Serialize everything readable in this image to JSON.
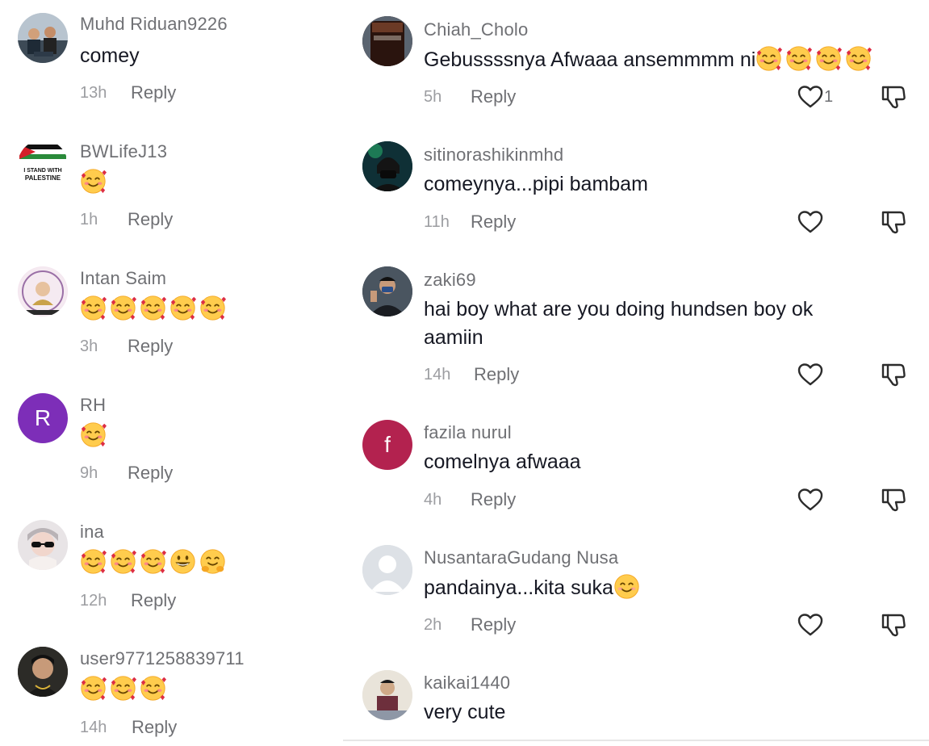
{
  "colors": {
    "text": "#161823",
    "muted": "#9c9da1",
    "secondary": "#6f7074",
    "avatar_r": "#7d2eb8",
    "avatar_f": "#b3224f"
  },
  "left_comments": [
    {
      "username": "Muhd Riduan9226",
      "text": "comey",
      "emojis": [],
      "time": "13h",
      "reply": "Reply"
    },
    {
      "username": "BWLifeJ13",
      "text": "",
      "emojis": [
        "smiling-face-with-hearts"
      ],
      "time": "1h",
      "reply": "Reply",
      "avatar_text": [
        "I STAND WITH",
        "PALESTINE"
      ]
    },
    {
      "username": "Intan Saim",
      "text": "",
      "emojis": [
        "smiling-face-with-hearts",
        "smiling-face-with-hearts",
        "smiling-face-with-hearts",
        "smiling-face-with-hearts",
        "smiling-face-with-hearts"
      ],
      "time": "3h",
      "reply": "Reply"
    },
    {
      "username": "RH",
      "text": "",
      "emojis": [
        "smiling-face-with-hearts"
      ],
      "time": "9h",
      "reply": "Reply",
      "avatar_letter": "R"
    },
    {
      "username": "ina",
      "text": "",
      "emojis": [
        "smiling-face-with-hearts",
        "smiling-face-with-hearts",
        "smiling-face-with-hearts",
        "grinning-face",
        "hugging-face"
      ],
      "time": "12h",
      "reply": "Reply"
    },
    {
      "username": "user9771258839711",
      "text": "",
      "emojis": [
        "smiling-face-with-hearts",
        "smiling-face-with-hearts",
        "smiling-face-with-hearts"
      ],
      "time": "14h",
      "reply": "Reply"
    }
  ],
  "right_comments": [
    {
      "username": "Chiah_Cholo",
      "text": "Gebussssnya Afwaaa ansemmmm ni",
      "emojis": [
        "smiling-face-with-hearts",
        "smiling-face-with-hearts",
        "smiling-face-with-hearts",
        "smiling-face-with-hearts"
      ],
      "time": "5h",
      "reply": "Reply",
      "likes": "1"
    },
    {
      "username": "sitinorashikinmhd",
      "text": "comeynya...pipi bambam",
      "emojis": [],
      "time": "11h",
      "reply": "Reply"
    },
    {
      "username": "zaki69",
      "text": "hai boy what are you doing hundsen boy ok aamiin",
      "emojis": [],
      "time": "14h",
      "reply": "Reply"
    },
    {
      "username": "fazila nurul",
      "text": "comelnya afwaaa",
      "emojis": [],
      "time": "4h",
      "reply": "Reply",
      "avatar_letter": "f"
    },
    {
      "username": "NusantaraGudang Nusa",
      "text": "pandainya...kita suka",
      "emojis": [
        "smiling-face"
      ],
      "time": "2h",
      "reply": "Reply"
    },
    {
      "username": "kaikai1440",
      "text": "very cute",
      "emojis": [],
      "time": "",
      "reply": ""
    }
  ]
}
